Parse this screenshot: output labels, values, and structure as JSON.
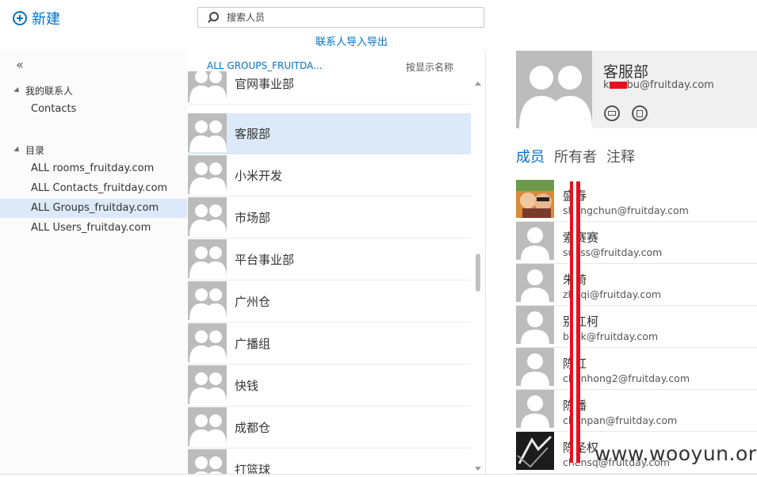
{
  "toolbar": {
    "new_label": "新建",
    "search_placeholder": "搜索人员",
    "import_export_label": "联系人导入导出"
  },
  "sidebar": {
    "collapse_glyph": "«",
    "my_contacts_label": "我的联系人",
    "my_contacts_items": [
      {
        "label": "Contacts"
      }
    ],
    "directory_label": "目录",
    "directory_items": [
      {
        "label": "ALL rooms_fruitday.com"
      },
      {
        "label": "ALL Contacts_fruitday.com"
      },
      {
        "label": "ALL Groups_fruitday.com",
        "selected": true
      },
      {
        "label": "ALL Users_fruitday.com"
      }
    ]
  },
  "list": {
    "header_title": "ALL GROUPS_FRUITDA...",
    "sort_label": "按显示名称",
    "rows": [
      {
        "name": "官网事业部"
      },
      {
        "name": "客服部",
        "selected": true
      },
      {
        "name": "小米开发"
      },
      {
        "name": "市场部"
      },
      {
        "name": "平台事业部"
      },
      {
        "name": "广州仓"
      },
      {
        "name": "广播组"
      },
      {
        "name": "快钱"
      },
      {
        "name": "成都仓"
      },
      {
        "name": "打篮球"
      }
    ]
  },
  "detail": {
    "name": "客服部",
    "email_prefix": "k",
    "email_suffix": "bu@fruitday.com",
    "tabs": [
      {
        "label": "成员",
        "active": true
      },
      {
        "label": "所有者"
      },
      {
        "label": "注释"
      }
    ],
    "members": [
      {
        "name": "盛春",
        "email": "shengchun@fruitday.com",
        "photo": "photo"
      },
      {
        "name": "索赛赛",
        "email": "suoss@fruitday.com",
        "photo": "placeholder"
      },
      {
        "name": "朱琦",
        "email": "zhuqi@fruitday.com",
        "photo": "placeholder"
      },
      {
        "name": "别江柯",
        "email": "biejk@fruitday.com",
        "photo": "placeholder"
      },
      {
        "name": "陈红",
        "email": "chenhong2@fruitday.com",
        "photo": "placeholder"
      },
      {
        "name": "陈潘",
        "email": "chenpan@fruitday.com",
        "photo": "placeholder"
      },
      {
        "name": "陈圣权",
        "email": "chensq@fruitday.com",
        "photo": "dark"
      }
    ]
  },
  "watermark": "www.wooyun.org",
  "colors": {
    "accent": "#0072c6",
    "selected_bg": "#dbe9f8",
    "avatar_grey": "#bcbcbc",
    "redaction": "#e8101e"
  }
}
